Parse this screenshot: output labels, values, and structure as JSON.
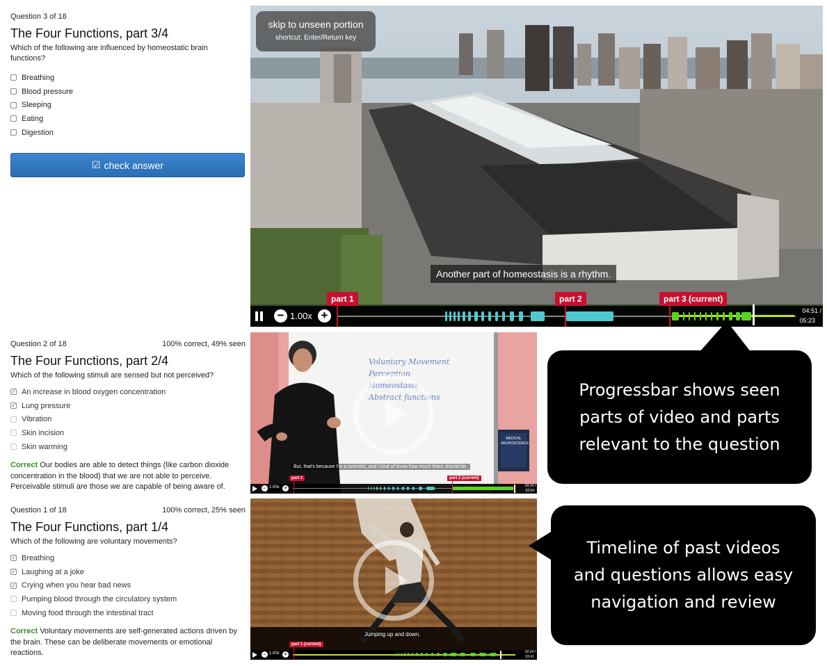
{
  "q3": {
    "meta": "Question 3 of 18",
    "title": "The Four Functions, part 3/4",
    "prompt": "Which of the following are influenced by homeostatic brain functions?",
    "choices": [
      "Breathing",
      "Blood pressure",
      "Sleeping",
      "Eating",
      "Digestion"
    ],
    "check_label": "check answer",
    "check_icon": "checkbox-icon"
  },
  "q2": {
    "meta": "Question 2 of 18",
    "stats": "100% correct, 49% seen",
    "title": "The Four Functions, part 2/4",
    "prompt": "Which of the following stimuli are sensed but not perceived?",
    "choices": [
      "An increase in blood oxygen concentration",
      "Lung pressure",
      "Vibration",
      "Skin incision",
      "Skin warming"
    ],
    "checked": [
      true,
      true,
      false,
      false,
      false
    ],
    "feedback_label": "Correct",
    "feedback": "Our bodies are able to detect things (like carbon dioxide concentration in the blood) that we are not able to perceive. Perceivable stimuli are those we are capable of being aware of."
  },
  "q1": {
    "meta": "Question 1 of 18",
    "stats": "100% correct, 25% seen",
    "title": "The Four Functions, part 1/4",
    "prompt": "Which of the following are voluntary movements?",
    "choices": [
      "Breathing",
      "Laughing at a joke",
      "Crying when you hear bad news",
      "Pumping blood through the circulatory system",
      "Moving food through the intestinal tract"
    ],
    "checked": [
      true,
      true,
      true,
      false,
      false
    ],
    "feedback_label": "Correct",
    "feedback": "Voluntary movements are self-generated actions driven by the brain. These can be deliberate movements or emotional reactions."
  },
  "main_video": {
    "skip_title": "skip to unseen portion",
    "skip_shortcut": "shortcut: Enter/Return key",
    "caption": "Another part of homeostasis is a rhythm.",
    "speed": "1.00x",
    "markers": [
      "part 1",
      "part 2",
      "part 3 (current)"
    ],
    "time_current": "04:51 /",
    "time_total": "05:23",
    "progress": 0.78
  },
  "video2": {
    "whiteboard": [
      "Voluntary Movement",
      "Perception",
      "Homeostasis",
      "Abstract functions"
    ],
    "book_title": "MEDICAL NEUROSCIENCE",
    "caption": "But, that's because I'm a scientist, and I kind of know how much there should be.",
    "speed": "1.00x",
    "markers": [
      "part 1",
      "part 2 (current)"
    ],
    "time_current": "03:14 /",
    "time_total": "03:54"
  },
  "video1": {
    "caption": "Jumping up and down.",
    "speed": "1.00x",
    "markers": [
      "part 1 (current)"
    ],
    "time_current": "02:24 /",
    "time_total": "03:41"
  },
  "callouts": {
    "progressbar": "Progressbar shows seen parts of video and parts relevant to the question",
    "timeline": "Timeline of past videos and questions allows easy navigation and review"
  },
  "colors": {
    "seen": "#4fc8cf",
    "relevant": "#a3e52e",
    "marker": "#c8102e",
    "button": "#2f76bf",
    "correct": "#3c8c2a"
  }
}
